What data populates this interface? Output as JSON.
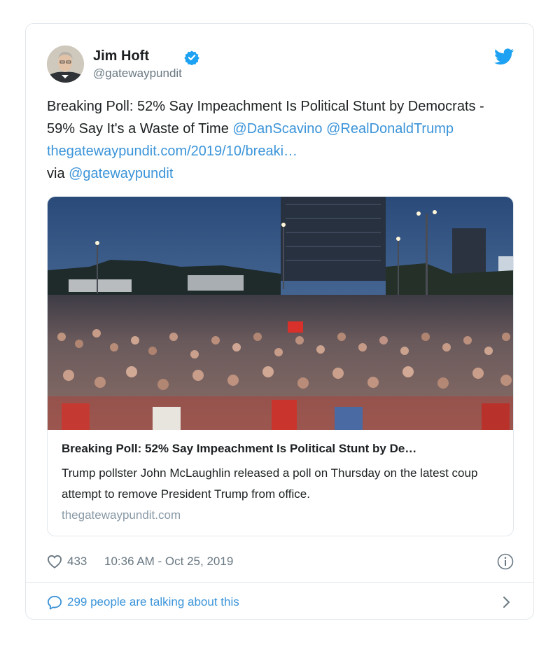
{
  "tweet": {
    "author_name": "Jim Hoft",
    "handle": "@gatewaypundit",
    "text_plain_1": "Breaking Poll: 52% Say Impeachment Is Political Stunt by Democrats - 59% Say It's a Waste of Time ",
    "mention_1": "@DanScavino",
    "mention_2": "@RealDonaldTrump",
    "link": "thegatewaypundit.com/2019/10/breaki…",
    "text_via": "via ",
    "mention_3": "@gatewaypundit",
    "likes": "433",
    "timestamp": "10:36 AM - Oct 25, 2019",
    "talking": "299 people are talking about this"
  },
  "card": {
    "title": "Breaking Poll: 52% Say Impeachment Is Political Stunt by De…",
    "description": "Trump pollster John McLaughlin released a poll on Thursday on the latest coup attempt to remove President Trump from office.",
    "domain": "thegatewaypundit.com"
  },
  "icons": {
    "verified": "verified-badge-icon",
    "bird": "twitter-bird-icon",
    "heart": "heart-icon",
    "info": "info-icon",
    "bubble": "speech-bubble-icon",
    "chevron": "chevron-right-icon"
  },
  "colors": {
    "link": "#3b94d9",
    "twitter_blue": "#1da1f2",
    "text": "#1c2022",
    "muted": "#697882",
    "border": "#e1e8ed"
  }
}
